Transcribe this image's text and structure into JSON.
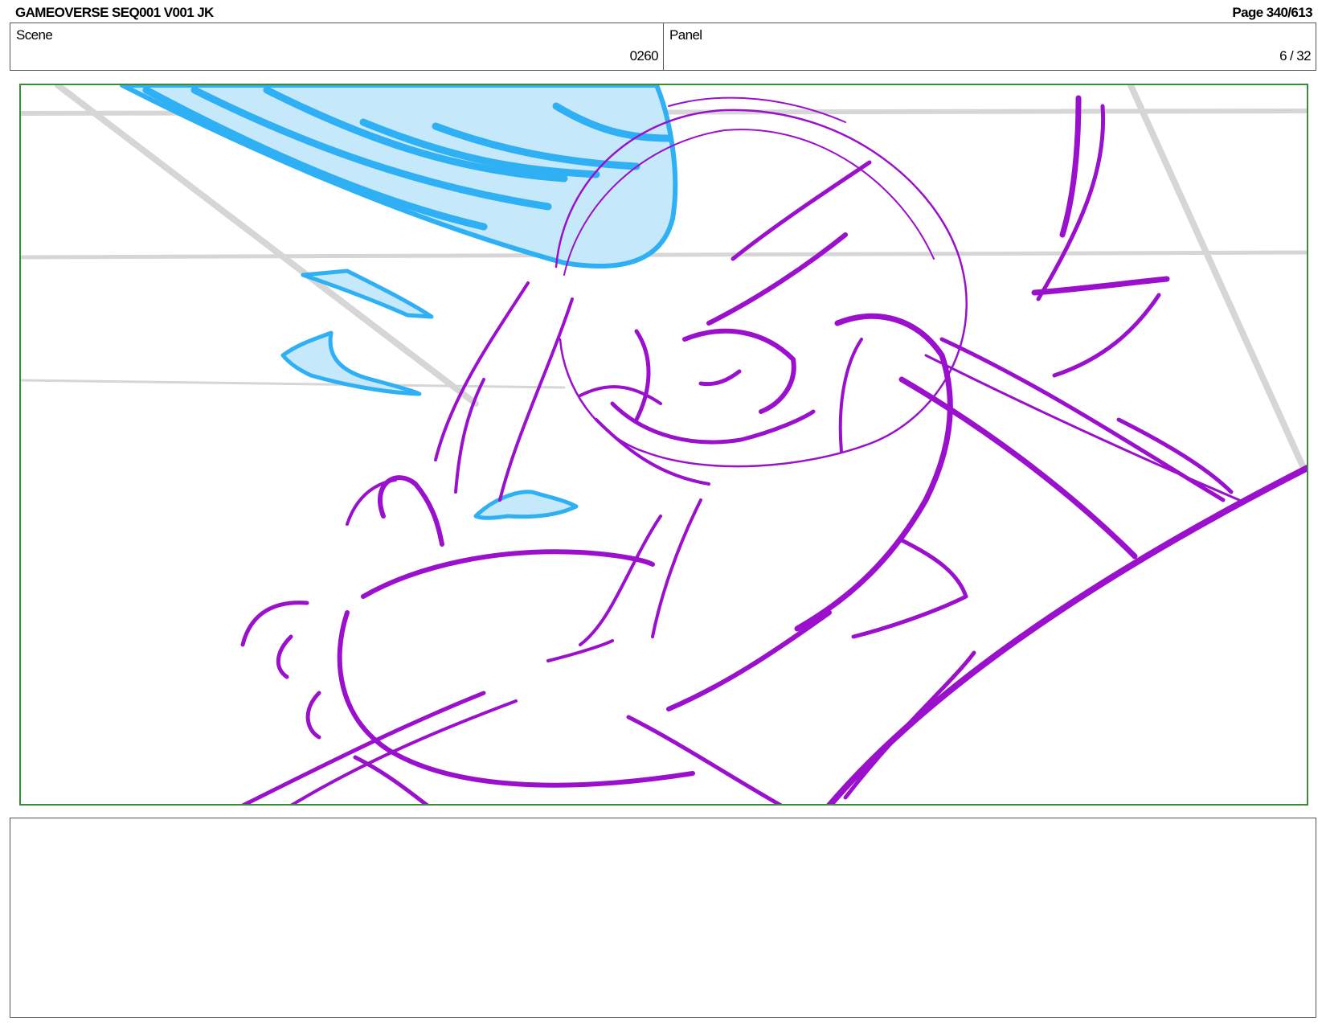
{
  "header": {
    "title": "GAMEOVERSE SEQ001 V001 JK",
    "page": "Page 340/613"
  },
  "info": {
    "scene_label": "Scene",
    "scene_value": "0260",
    "panel_label": "Panel",
    "panel_value": "6 / 32"
  },
  "artwork": {
    "description_colors": {
      "character_lines": "#9a10cc",
      "effect_lines": "#2fb0f5",
      "effect_fill": "#c6e8fb",
      "background_grid": "#d6d6d6",
      "frame_border": "#3c8a3c"
    }
  },
  "notes": {
    "text": ""
  }
}
